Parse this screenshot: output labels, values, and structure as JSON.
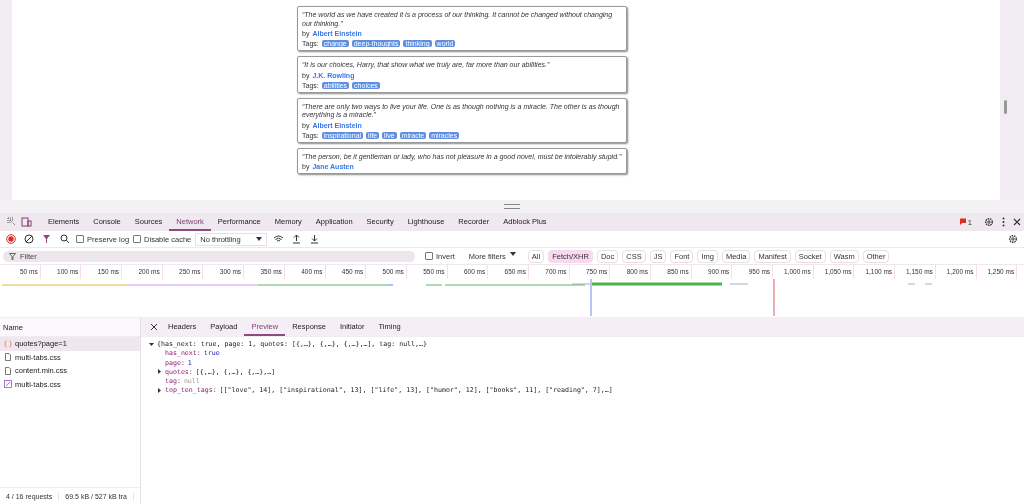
{
  "page": {
    "quotes": [
      {
        "text": "“The world as we have created it is a process of our thinking. It cannot be changed without changing our thinking.”",
        "by": "by",
        "author": "Albert Einstein",
        "tags_label": "Tags:",
        "tags": [
          "change",
          "deep-thoughts",
          "thinking",
          "world"
        ]
      },
      {
        "text": "“It is our choices, Harry, that show what we truly are, far more than our abilities.”",
        "by": "by",
        "author": "J.K. Rowling",
        "tags_label": "Tags:",
        "tags": [
          "abilities",
          "choices"
        ]
      },
      {
        "text": "“There are only two ways to live your life. One is as though nothing is a miracle. The other is as though everything is a miracle.”",
        "by": "by",
        "author": "Albert Einstein",
        "tags_label": "Tags:",
        "tags": [
          "inspirational",
          "life",
          "live",
          "miracle",
          "miracles"
        ]
      },
      {
        "text": "“The person, be it gentleman or lady, who has not pleasure in a good novel, must be intolerably stupid.”",
        "by": "by",
        "author": "Jane Austen"
      }
    ]
  },
  "devtools": {
    "tabs": [
      {
        "label": "Elements",
        "selected": false
      },
      {
        "label": "Console",
        "selected": false
      },
      {
        "label": "Sources",
        "selected": false
      },
      {
        "label": "Network",
        "selected": true
      },
      {
        "label": "Performance",
        "selected": false
      },
      {
        "label": "Memory",
        "selected": false
      },
      {
        "label": "Application",
        "selected": false
      },
      {
        "label": "Security",
        "selected": false
      },
      {
        "label": "Lighthouse",
        "selected": false
      },
      {
        "label": "Recorder",
        "selected": false
      },
      {
        "label": "Adblock Plus",
        "selected": false
      }
    ],
    "issues_count": "1",
    "toolbar": {
      "preserve_log": {
        "label": "Preserve log",
        "checked": false
      },
      "disable_cache": {
        "label": "Disable cache",
        "checked": false
      },
      "throttling": "No throttling"
    },
    "filter": {
      "placeholder": "Filter",
      "invert": {
        "label": "Invert",
        "checked": false
      },
      "more_filters": "More filters",
      "types": [
        {
          "label": "All",
          "selected": false
        },
        {
          "label": "Fetch/XHR",
          "selected": true
        },
        {
          "label": "Doc",
          "selected": false
        },
        {
          "label": "CSS",
          "selected": false
        },
        {
          "label": "JS",
          "selected": false
        },
        {
          "label": "Font",
          "selected": false
        },
        {
          "label": "Img",
          "selected": false
        },
        {
          "label": "Media",
          "selected": false
        },
        {
          "label": "Manifest",
          "selected": false
        },
        {
          "label": "Socket",
          "selected": false
        },
        {
          "label": "Wasm",
          "selected": false
        },
        {
          "label": "Other",
          "selected": false
        }
      ]
    },
    "timeline_ticks": [
      "50 ms",
      "100 ms",
      "150 ms",
      "200 ms",
      "250 ms",
      "300 ms",
      "350 ms",
      "400 ms",
      "450 ms",
      "500 ms",
      "550 ms",
      "600 ms",
      "650 ms",
      "700 ms",
      "750 ms",
      "800 ms",
      "850 ms",
      "900 ms",
      "950 ms",
      "1,000 ms",
      "1,050 ms",
      "1,100 ms",
      "1,150 ms",
      "1,200 ms",
      "1,250 ms"
    ],
    "requests_header": "Name",
    "requests": [
      {
        "name": "quotes?page=1",
        "kind": "fetch",
        "selected": true
      },
      {
        "name": "multi-tabs.css",
        "kind": "doc",
        "selected": false
      },
      {
        "name": "content.min.css",
        "kind": "doc",
        "selected": false
      },
      {
        "name": "multi-tabs.css",
        "kind": "style",
        "selected": false
      }
    ],
    "detail_tabs": [
      {
        "label": "Headers",
        "selected": false
      },
      {
        "label": "Payload",
        "selected": false
      },
      {
        "label": "Preview",
        "selected": true
      },
      {
        "label": "Response",
        "selected": false
      },
      {
        "label": "Initiator",
        "selected": false
      },
      {
        "label": "Timing",
        "selected": false
      }
    ],
    "preview": {
      "summary": "{has_next: true, page: 1, quotes: [{,…}, {,…}, {,…},…], tag: null,…}",
      "lines": [
        {
          "key": "has_next:",
          "value": "true",
          "kind": "bool"
        },
        {
          "key": "page:",
          "value": "1",
          "kind": "number"
        },
        {
          "key": "quotes:",
          "value": "[{,…}, {,…}, {,…},…]",
          "kind": "object"
        },
        {
          "key": "tag:",
          "value": "null",
          "kind": "null"
        },
        {
          "key": "top_ten_tags:",
          "value": "[[\"love\", 14], [\"inspirational\", 13], [\"life\", 13], [\"humor\", 12], [\"books\", 11], [\"reading\", 7],…]",
          "kind": "object"
        }
      ]
    },
    "status": {
      "requests": "4 / 16 requests",
      "transferred": "69.5 kB / 527 kB tra"
    }
  }
}
